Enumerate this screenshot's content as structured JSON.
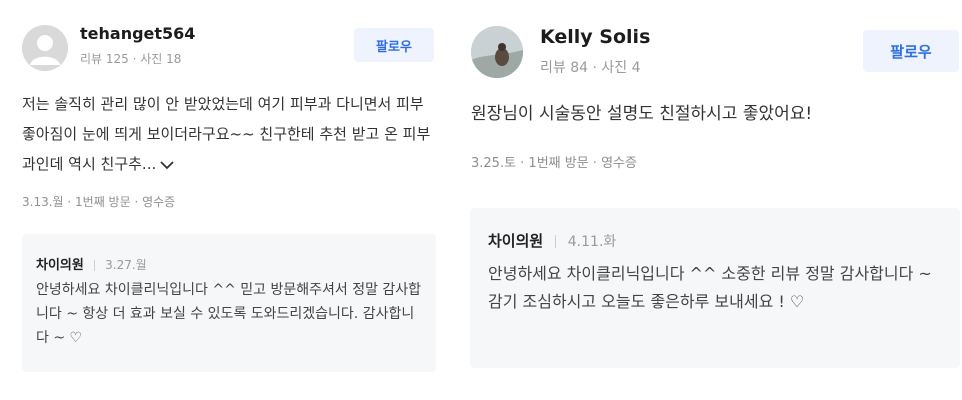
{
  "reviews": [
    {
      "username": "tehanget564",
      "stats": "리뷰 125 · 사진 18",
      "follow_label": "팔로우",
      "text": "저는 솔직히 관리 많이 안 받았었는데 여기 피부과 다니면서 피부 좋아짐이 눈에 띄게 보이더라구요~~ 친구한테 추천 받고 온 피부과인데 역시 친구추...",
      "visit_info": "3.13.월 · 1번째 방문 · 영수증",
      "reply": {
        "author": "차이의원",
        "date": "3.27.월",
        "text": "안녕하세요 차이클리닉입니다 ^^ 믿고 방문해주셔서 정말 감사합니다 ~ 항상 더 효과 보실 수 있도록 도와드리겠습니다. 감사합니다 ~ ♡"
      }
    },
    {
      "username": "Kelly Solis",
      "stats": "리뷰 84 · 사진 4",
      "follow_label": "팔로우",
      "text": "원장님이 시술동안 설명도 친절하시고 좋았어요!",
      "visit_info": "3.25.토 · 1번째 방문 · 영수증",
      "reply": {
        "author": "차이의원",
        "date": "4.11.화",
        "text": "안녕하세요 차이클리닉입니다 ^^ 소중한 리뷰 정말 감사합니다 ~ 감기 조심하시고 오늘도 좋은하루 보내세요 ! ♡"
      }
    }
  ],
  "colors": {
    "follow_bg": "#eef3fd",
    "follow_text": "#2f6fe4",
    "reply_bg": "#f6f7f9",
    "meta": "#9a9a9a"
  },
  "icons": {
    "expand": "chevron-down-icon",
    "default_avatar": "user-silhouette-icon"
  }
}
